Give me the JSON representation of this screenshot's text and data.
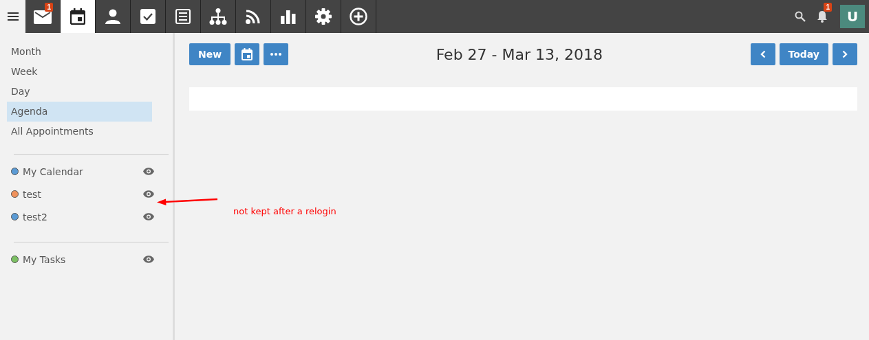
{
  "topbar": {
    "tabs": [
      {
        "kind": "mail",
        "selected": false,
        "badge": "1"
      },
      {
        "kind": "calendar",
        "selected": true
      },
      {
        "kind": "person",
        "selected": false
      },
      {
        "kind": "check",
        "selected": false
      },
      {
        "kind": "list",
        "selected": false
      },
      {
        "kind": "org",
        "selected": false
      },
      {
        "kind": "rss",
        "selected": false
      },
      {
        "kind": "chart",
        "selected": false
      },
      {
        "kind": "gear",
        "selected": false
      },
      {
        "kind": "plus",
        "selected": false
      }
    ],
    "notifications_badge": "1",
    "avatar": "U"
  },
  "sidebar": {
    "views": [
      {
        "label": "Month",
        "selected": false
      },
      {
        "label": "Week",
        "selected": false
      },
      {
        "label": "Day",
        "selected": false
      },
      {
        "label": "Agenda",
        "selected": true
      },
      {
        "label": "All Appointments",
        "selected": false
      }
    ],
    "calendars": [
      {
        "label": "My Calendar",
        "color": "#5b9bd5"
      },
      {
        "label": "test",
        "color": "#f0925c"
      },
      {
        "label": "test2",
        "color": "#5b9bd5"
      }
    ],
    "tasks": [
      {
        "label": "My Tasks",
        "color": "#7cc063"
      }
    ]
  },
  "toolbar": {
    "new_button": "New",
    "title": "Feb 27 - Mar 13, 2018",
    "today_button": "Today"
  },
  "annotation": {
    "text": "not kept after a relogin"
  }
}
